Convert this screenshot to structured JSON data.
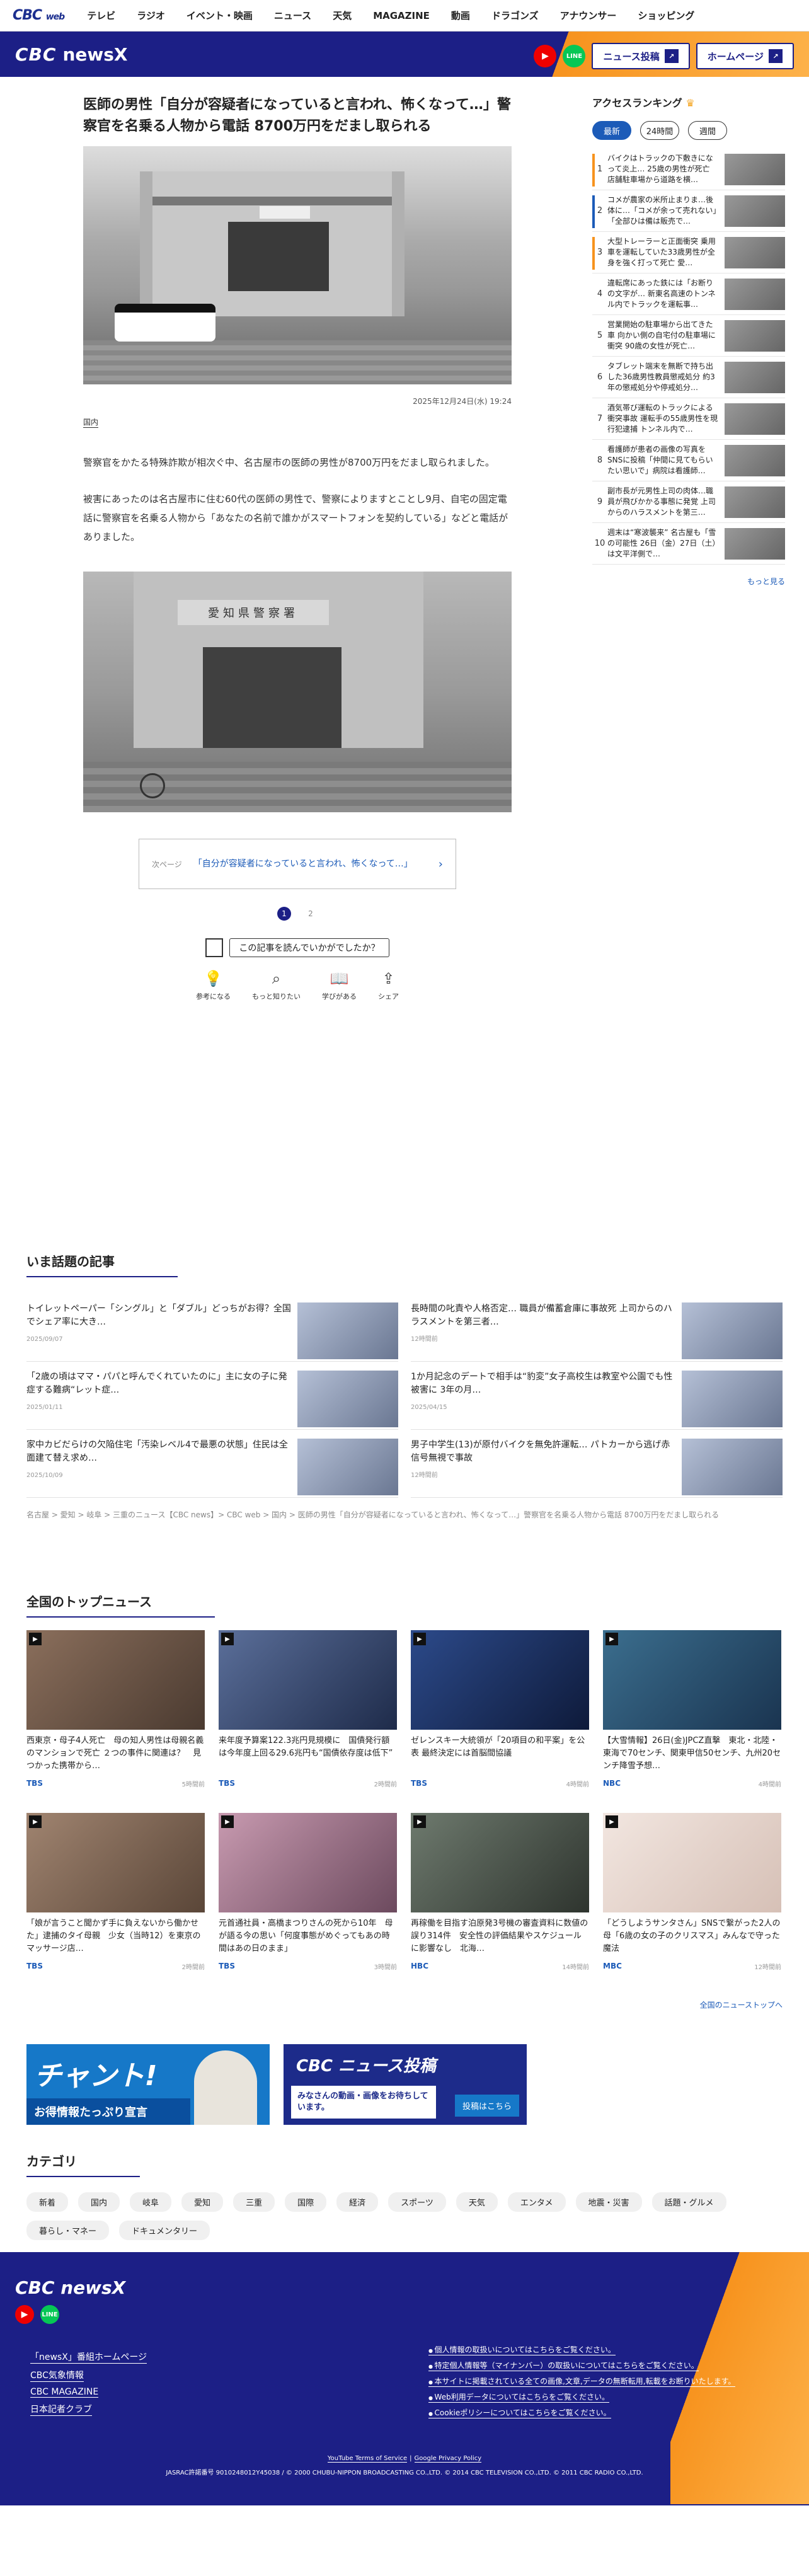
{
  "gnav": {
    "logo_main": "CBC",
    "logo_sub": "web",
    "items": [
      "テレビ",
      "ラジオ",
      "イベント・映画",
      "ニュース",
      "天気",
      "MAGAZINE",
      "動画",
      "ドラゴンズ",
      "アナウンサー",
      "ショッピング"
    ]
  },
  "header": {
    "brand_cbc": "CBC",
    "brand_news": "newsX",
    "post_button": "ニュース投稿",
    "home_button": "ホームページ"
  },
  "article": {
    "title": "医師の男性「自分が容疑者になっていると言われ、怖くなって…」警察官を名乗る人物から電話 8700万円をだまし取られる",
    "date": "2025年12月24日(水) 19:24",
    "tag": "国内",
    "paragraphs": [
      "警察官をかたる特殊詐欺が相次ぐ中、名古屋市の医師の男性が8700万円をだまし取られました。",
      "被害にあったのは名古屋市に住む60代の医師の男性で、警察によりますとことし9月、自宅の固定電話に警察官を名乗る人物から「あなたの名前で誰かがスマートフォンを契約している」などと電話がありました。"
    ],
    "next_label": "次ページ",
    "next_title": "「自分が容疑者になっていると言われ、怖くなって…」",
    "pages": [
      "1",
      "2"
    ],
    "survey": "この記事を読んでいかがでしたか？",
    "reactions": [
      "参考になる",
      "もっと知りたい",
      "学びがある",
      "シェア"
    ]
  },
  "sidebar": {
    "title": "アクセスランキング",
    "tabs": [
      "最新",
      "24時間",
      "週間"
    ],
    "items": [
      {
        "num": "1",
        "text": "バイクはトラックの下敷きになって炎上… 25歳の男性が死亡 店舗駐車場から道路を横…",
        "color": "#f7931e"
      },
      {
        "num": "2",
        "text": "コメが農家の米所止まりま…後体に…「コメが余って売れない」「全部ひは備は販売で…",
        "color": "#1c5bb8"
      },
      {
        "num": "3",
        "text": "大型トレーラーと正面衝突 乗用車を運転していた33歳男性が全身を強く打って死亡 愛…",
        "color": "#f7931e"
      },
      {
        "num": "4",
        "text": "違転席にあった鉄には「お断りの文字が… 新東名高速のトンネル内でトラックを運転事…",
        "color": "#ffffff"
      },
      {
        "num": "5",
        "text": "営業開始の駐車場から出てきた車 向かい側の自宅付の駐車場に衝突 90歳の女性が死亡…",
        "color": "#ffffff"
      },
      {
        "num": "6",
        "text": "タブレット端末を無断で持ち出した36歳男性教員懲戒処分 約3年の懲戒処分や停戒処分…",
        "color": "#ffffff"
      },
      {
        "num": "7",
        "text": "酒気帯び運転のトラックによる衝突事故 運転手の55歳男性を現行犯逮捕 トンネル内で…",
        "color": "#ffffff"
      },
      {
        "num": "8",
        "text": "看護師が患者の画像の写真をSNSに投稿「仲間に見てもらいたい思いで」病院は看護師…",
        "color": "#ffffff"
      },
      {
        "num": "9",
        "text": "副市長が元男性上司の肉体…職員が飛びかかる事態に発覚 上司からのハラスメントを第三…",
        "color": "#ffffff"
      },
      {
        "num": "10",
        "text": "週末は“寒波襲来” 名古屋も「雪の可能性 26日（金）27日（土）は文平洋側で…",
        "color": "#ffffff"
      }
    ],
    "more": "もっと見る"
  },
  "hot": {
    "title": "いま話題の記事",
    "items": [
      {
        "text": "トイレットペーパー「シングル」と「ダブル」どっちがお得？全国でシェア率に大き…",
        "date": "2025/09/07"
      },
      {
        "text": "長時間の叱責や人格否定… 職員が備蓄倉庫に事故死 上司からのハラスメントを第三者…",
        "date": "12時間前"
      },
      {
        "text": "「2歳の頃はママ・パパと呼んでくれていたのに」主に女の子に発症する難病“レット症…",
        "date": "2025/01/11"
      },
      {
        "text": "1か月記念のデートで相手は“豹変”女子高校生は教室や公園でも性被害に 3年の月…",
        "date": "2025/04/15"
      },
      {
        "text": "家中カビだらけの欠陥住宅「汚染レベル4で最悪の状態」住民は全面建て替え求め…",
        "date": "2025/10/09"
      },
      {
        "text": "男子中学生(13)が原付バイクを無免許運転… パトカーから逃げ赤信号無視で事故",
        "date": "12時間前"
      }
    ],
    "crumbs": "名古屋 > 愛知 > 岐阜 > 三重のニュース【CBC news】> CBC web > 国内 > 医師の男性「自分が容疑者になっていると言われ、怖くなって…」警察官を名乗る人物から電話 8700万円をだまし取られる"
  },
  "top": {
    "title": "全国のトップニュース",
    "items": [
      {
        "text": "西東京・母子4人死亡　母の知人男性は母親名義のマンションで死亡 ２つの事件に関連は？　見つかった携帯から…",
        "src": "TBS",
        "ago": "5時間前",
        "c1": "#8b6f5c",
        "c2": "#4a3a30"
      },
      {
        "text": "来年度予算案122.3兆円見規模に　国債発行額は今年度上回る29.6兆円も“国債依存度は低下”",
        "src": "TBS",
        "ago": "2時間前",
        "c1": "#5b6f9a",
        "c2": "#1e2b4a"
      },
      {
        "text": "ゼレンスキー大統領が「20項目の和平案」を公表 最終決定には首脳間協議",
        "src": "TBS",
        "ago": "4時間前",
        "c1": "#2c4a8a",
        "c2": "#0e1a3a"
      },
      {
        "text": "【大雪情報】26日(金)JPCZ直撃　東北・北陸・東海で70センチ、関東甲信50センチ、九州20センチ降雪予想…",
        "src": "NBC",
        "ago": "4時間前",
        "c1": "#3b6e8e",
        "c2": "#1a3450"
      },
      {
        "text": "「娘が言うこと聞かず手に負えないから働かせた」逮捕のタイ母親　少女（当時12）を東京のマッサージ店…",
        "src": "TBS",
        "ago": "2時間前",
        "c1": "#a08470",
        "c2": "#5a4638"
      },
      {
        "text": "元首通社員・高橋まつりさんの死から10年　母が語る今の思い「何度事態がめぐってもあの時間はあの日のまま」",
        "src": "TBS",
        "ago": "3時間前",
        "c1": "#c89ab0",
        "c2": "#6c4a5e"
      },
      {
        "text": "再稼働を目指す泊原発3号機の審査資料に数値の誤り314件　安全性の評価結果やスケジュールに影響なし　北海…",
        "src": "HBC",
        "ago": "14時間前",
        "c1": "#6e7a6e",
        "c2": "#2e342e"
      },
      {
        "text": "「どうしようサンタさん」SNSで繋がった2人の母「6歳の女の子のクリスマス」みんなで守った魔法",
        "src": "MBC",
        "ago": "12時間前",
        "c1": "#f2e6e0",
        "c2": "#d6c0b6"
      }
    ],
    "more": "全国のニューストップへ"
  },
  "banners": {
    "b1_big": "チャント!",
    "b1_sub": "お得情報たっぷり宣言",
    "b2_big": "CBC ニュース投稿",
    "b2_sub": "みなさんの動画・画像をお待ちしています。",
    "b2_btn": "投稿はこちら"
  },
  "cats": {
    "title": "カテゴリ",
    "items": [
      "新着",
      "国内",
      "岐阜",
      "愛知",
      "三重",
      "国際",
      "経済",
      "スポーツ",
      "天気",
      "エンタメ",
      "地震・災害",
      "話題・グルメ",
      "暮らし・マネー",
      "ドキュメンタリー"
    ]
  },
  "footer": {
    "brand": "CBC newsX",
    "links": [
      "「newsX」番組ホームページ",
      "CBC気象情報",
      "CBC MAGAZINE",
      "日本記者クラブ"
    ],
    "policies": [
      "個人情報の取扱いについてはこちらをご覧ください。",
      "特定個人情報等（マイナンバー）の取扱いについてはこちらをご覧ください。",
      "本サイトに掲載されている全ての画像,文章,データの無断転用,転載をお断りいたします。",
      "Web利用データについてはこちらをご覧ください。",
      "Cookieポリシーについてはこちらをご覧ください。"
    ],
    "yt_terms": "YouTube Terms of Service",
    "google_policy": "Google Privacy Policy",
    "copyright": "JASRAC許諾番号 9010248012Y45038 / © 2000 CHUBU-NIPPON BROADCASTING CO.,LTD. © 2014 CBC TELEVISION CO.,LTD. © 2011 CBC RADIO CO.,LTD."
  }
}
